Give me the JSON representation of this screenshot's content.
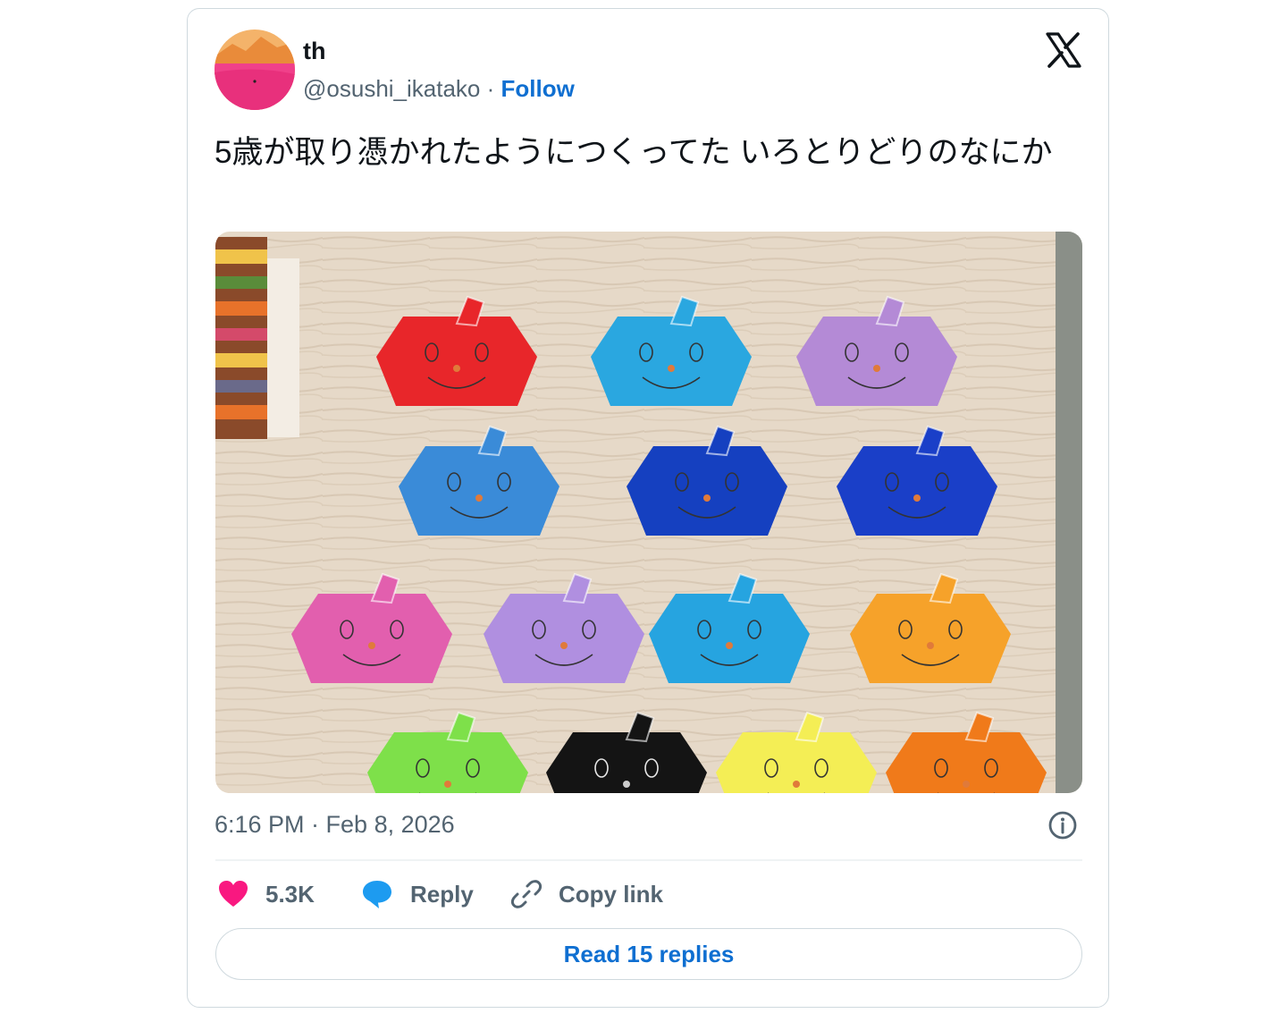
{
  "author": {
    "display_name": "th",
    "handle": "@osushi_ikatako",
    "separator": " · ",
    "follow_label": "Follow"
  },
  "tweet": {
    "text": "5歳が取り憑かれたようにつくってた いろとりどりのなにか",
    "timestamp": "6:16 PM · Feb 8, 2026"
  },
  "media": {
    "ghost_colors": [
      [
        "#e8262a",
        "#2aa7e0",
        "#b48ad6"
      ],
      [
        "#3a8bd8",
        "#1540c0",
        "#1a3fc8"
      ],
      [
        "#e25fae",
        "#b08fe0",
        "#26a4e0",
        "#f6a22a"
      ],
      [
        "#7ee04a",
        "#141414",
        "#f4ee55",
        "#f07a1a"
      ]
    ]
  },
  "actions": {
    "like_count": "5.3K",
    "reply_label": "Reply",
    "copy_link_label": "Copy link"
  },
  "footer": {
    "read_replies_label": "Read 15 replies"
  },
  "colors": {
    "accent": "#0f6fd1",
    "heart": "#f91880",
    "reply_bubble": "#1d9bf0"
  },
  "icons": {
    "platform": "x-logo-icon",
    "info": "info-icon",
    "like": "heart-icon",
    "reply": "speech-bubble-icon",
    "copy": "link-icon"
  }
}
